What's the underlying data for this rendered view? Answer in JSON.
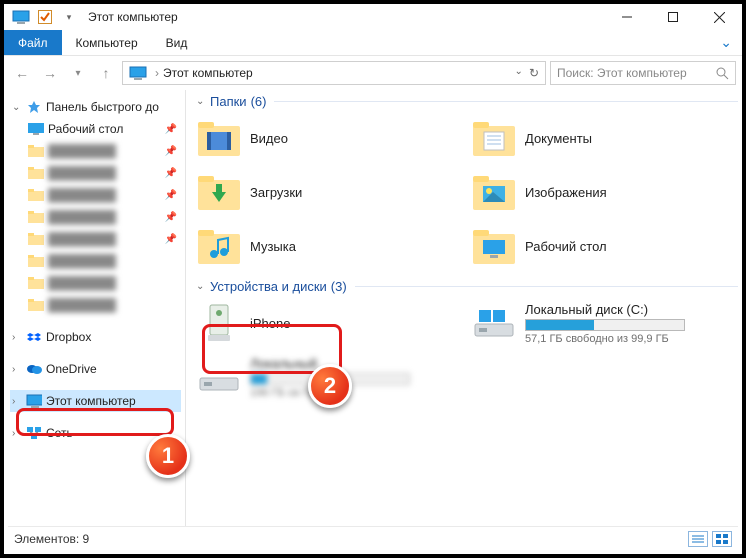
{
  "window": {
    "title": "Этот компьютер"
  },
  "ribbon": {
    "file": "Файл",
    "computer": "Компьютер",
    "view": "Вид"
  },
  "address": {
    "location": "Этот компьютер"
  },
  "search": {
    "placeholder": "Поиск: Этот компьютер"
  },
  "tree": {
    "quick_access": "Панель быстрого до",
    "desktop": "Рабочий стол",
    "dropbox": "Dropbox",
    "onedrive": "OneDrive",
    "this_pc": "Этот компьютер",
    "network": "Сеть"
  },
  "groups": {
    "folders": {
      "label": "Папки",
      "count": "(6)"
    },
    "devices": {
      "label": "Устройства и диски",
      "count": "(3)"
    }
  },
  "folders": {
    "video": "Видео",
    "documents": "Документы",
    "downloads": "Загрузки",
    "pictures": "Изображения",
    "music": "Музыка",
    "desktop": "Рабочий стол"
  },
  "devices": {
    "iphone": {
      "name": "iPhone"
    },
    "c_drive": {
      "name": "Локальный диск (C:)",
      "sub": "57,1 ГБ свободно из 99,9 ГБ",
      "fill_pct": 43
    },
    "other_drive": {
      "name": "Локальный",
      "sub": "196 ГБ св                           ГБ"
    }
  },
  "status": {
    "count_label": "Элементов: 9"
  },
  "annotations": {
    "step1": "1",
    "step2": "2"
  }
}
